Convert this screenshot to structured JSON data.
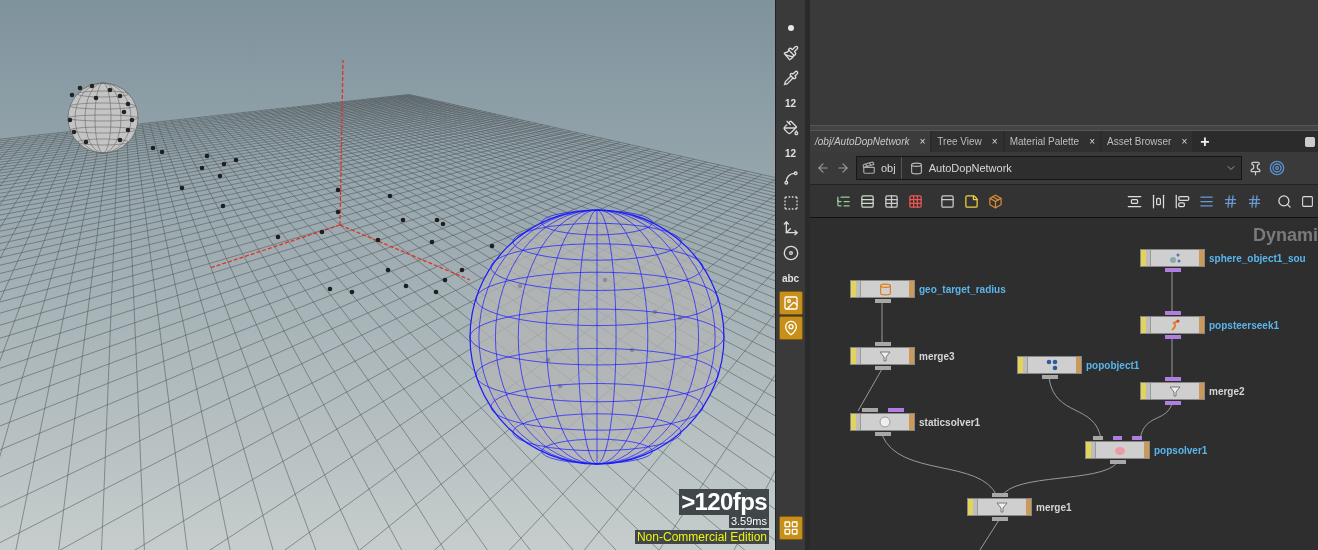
{
  "viewport": {
    "fps": ">120fps",
    "frame_time": "3.59ms",
    "edition": "Non-Commercial Edition"
  },
  "viewport_tools": [
    {
      "kind": "point",
      "on": false
    },
    {
      "kind": "brush",
      "on": false
    },
    {
      "kind": "pipette",
      "on": false
    },
    {
      "kind": "number",
      "label": "12",
      "on": false
    },
    {
      "kind": "paint",
      "on": false
    },
    {
      "kind": "number",
      "label": "12",
      "on": false
    },
    {
      "kind": "curve",
      "on": false
    },
    {
      "kind": "select",
      "on": false
    },
    {
      "kind": "handle",
      "on": false
    },
    {
      "kind": "disk",
      "on": false
    },
    {
      "kind": "text",
      "label": "abc",
      "on": false
    },
    {
      "kind": "image",
      "on": true
    },
    {
      "kind": "pin",
      "on": true
    },
    {
      "kind": "grid",
      "on": true
    }
  ],
  "tabs": [
    {
      "label": "/obj/AutoDopNetwork",
      "selected": true,
      "close": "×"
    },
    {
      "label": "Tree View",
      "selected": false,
      "close": "×"
    },
    {
      "label": "Material Palette",
      "selected": false,
      "close": "×"
    },
    {
      "label": "Asset Browser",
      "selected": false,
      "close": "×"
    }
  ],
  "new_tab": "+",
  "path": {
    "segments": [
      "obj",
      "AutoDopNetwork"
    ]
  },
  "network": {
    "context": "Dynami",
    "nodes": [
      {
        "name": "geo_target_radius",
        "kind": "geometry",
        "color": "#5ab5ec"
      },
      {
        "name": "merge3",
        "kind": "merge",
        "color": "#d6d6d6"
      },
      {
        "name": "staticsolver1",
        "kind": "solver",
        "color": "#d6d6d6"
      },
      {
        "name": "popobject1",
        "kind": "object",
        "color": "#5ab5ec"
      },
      {
        "name": "sphere_object1_sou",
        "kind": "source",
        "color": "#5ab5ec"
      },
      {
        "name": "popsteerseek1",
        "kind": "steer",
        "color": "#5ab5ec"
      },
      {
        "name": "merge2",
        "kind": "merge",
        "color": "#d6d6d6"
      },
      {
        "name": "popsolver1",
        "kind": "popsolver",
        "color": "#5ab5ec"
      },
      {
        "name": "merge1",
        "kind": "merge",
        "color": "#d6d6d6"
      }
    ]
  }
}
